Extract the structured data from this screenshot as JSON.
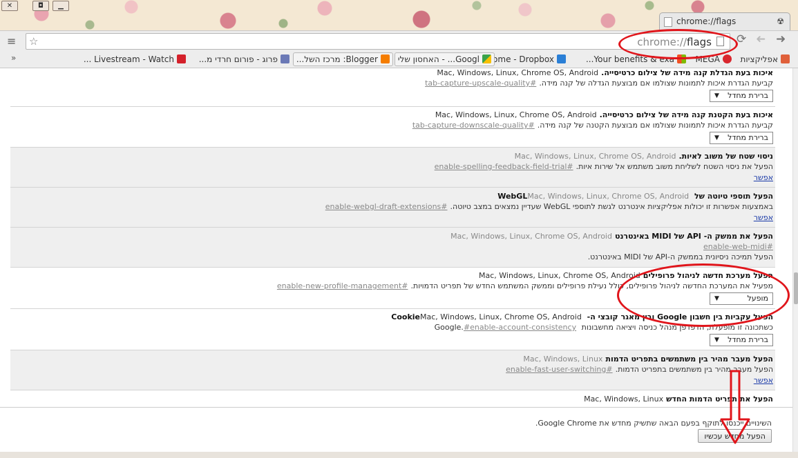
{
  "window": {
    "controls": {
      "close": "✕",
      "restore": "◘",
      "minimize": "▁"
    }
  },
  "tab": {
    "title": "chrome://flags",
    "tab_icon": "radiation-icon"
  },
  "toolbar": {
    "url_scheme": "chrome://",
    "url_path": "flags",
    "icons": {
      "star": "☆",
      "menu": "≡",
      "reload": "⟳",
      "back": "➜",
      "forward": "➜",
      "page": "page-icon"
    }
  },
  "bookmarks": {
    "more": "»",
    "items": [
      {
        "label": "אפליקציות",
        "icon": "apps-icon",
        "color": "#e0603a"
      },
      {
        "label": "MEGA",
        "icon": "mega-icon",
        "color": "#d9272e"
      },
      {
        "label": "Your benefits & exa...",
        "icon": "windows-icon",
        "color": "#2f9fe0"
      },
      {
        "label": "Home - Dropbox",
        "icon": "dropbox-icon",
        "color": "#2a7fd6"
      },
      {
        "label": "Googl... - האחסון שלי",
        "icon": "drive-icon",
        "color": "#3aa34a"
      },
      {
        "label": "Blogger: מרכז השל...",
        "icon": "blogger-icon",
        "color": "#f57d00"
      },
      {
        "label": "פרוג - פורום חרדי מ...",
        "icon": "forum-icon",
        "color": "#6b79b6"
      },
      {
        "label": "Livestream - Watch ...",
        "icon": "livestream-icon",
        "color": "#d4202a"
      }
    ]
  },
  "experiments": [
    {
      "name": "איכות בעת הגדלת קנה מידה של צילום כרטיסייה.",
      "platforms": "Mac, Windows, Linux, Chrome OS, Android",
      "description": "קביעת הגדרת איכות לתמונות שצולמו אם מבוצעת הגדלה של קנה מידה.",
      "anchor": "#tab-capture-upscale-quality",
      "control": "select",
      "value": "ברירת מחדל"
    },
    {
      "name": "איכות בעת הקטנת קנה מידה של צילום כרטיסייה.",
      "platforms": "Mac, Windows, Linux, Chrome OS, Android",
      "description": "קביעת הגדרת איכות לתמונות שצולמו אם מבוצעת הקטנה של קנה מידה.",
      "anchor": "#tab-capture-downscale-quality",
      "control": "select",
      "value": "ברירת מחדל"
    },
    {
      "name": "ניסוי שטח של משוב לאיות.",
      "platforms": "Mac, Windows, Linux, Chrome OS, Android",
      "description": "הפעל את ניסוי השטח לשליחת משוב משתמש אל שירות איות.",
      "anchor": "#enable-spelling-feedback-field-trial",
      "control": "link",
      "value": "אפשר",
      "unsupported": true
    },
    {
      "name": "הפעל תוספי טיוטה של WebGL",
      "platforms": "Mac, Windows, Linux, Chrome OS, Android",
      "description": "באמצעות אפשרות זו יכולות אפליקציות אינטרנט לגשת לתוספי WebGL שעדיין נמצאים במצב טיוטה.",
      "anchor": "#enable-webgl-draft-extensions",
      "control": "link",
      "value": "אפשר",
      "unsupported": true
    },
    {
      "name": "הפעל את ממשק ה- API של MIDI באינטרנט",
      "platforms": "Mac, Windows, Linux, Chrome OS, Android",
      "description": "הפעל תמיכה ניסיונית בממשק ה-API של MIDI באינטרנט.",
      "anchor": "#enable-web-midi",
      "control": "link",
      "value": "אפשר",
      "unsupported": true
    },
    {
      "name": "הפעל מערכת חדשה לניהול פרופילים",
      "platforms": "Mac, Windows, Linux, Chrome OS, Android",
      "description": "מפעיל את המערכת החדשה לניהול פרופילים, כולל נעילת פרופילים וממשק המשתמש החדש של תפריט הדמויות.",
      "anchor": "#enable-new-profile-management",
      "control": "select",
      "value": "מופעל"
    },
    {
      "name": "הפעל עקביות בין חשבון Google ובין מאגר קובצי ה- Cookie",
      "platforms": "Mac, Windows, Linux, Chrome OS, Android",
      "description": "כשתכונה זו מופעלת, הדפדפן מנהל כניסה ויציאה מחשבונות Google.",
      "anchor": "#enable-account-consistency",
      "control": "select",
      "value": "ברירת מחדל"
    },
    {
      "name": "הפעל מעבר מהיר בין משתמשים בתפריט הדמות",
      "platforms": "Mac, Windows, Linux",
      "description": "הפעל מעבר מהיר בין משתמשים בתפריט הדמות.",
      "anchor": "#enable-fast-user-switching",
      "control": "link",
      "value": "אפשר",
      "unsupported": true
    },
    {
      "name": "הפעל את תפריט הדמות החדש",
      "platforms": "Mac, Windows, Linux",
      "description": "",
      "anchor": "",
      "control": "none",
      "value": ""
    }
  ],
  "footer": {
    "note": "השינויים ייכנסו לתוקף בפעם הבאה שתשיק מחדש את Google Chrome.",
    "relaunch_label": "הפעל מחדש עכשיו"
  },
  "colors": {
    "annotation": "#e0151b",
    "link": "#1a3aa8"
  }
}
